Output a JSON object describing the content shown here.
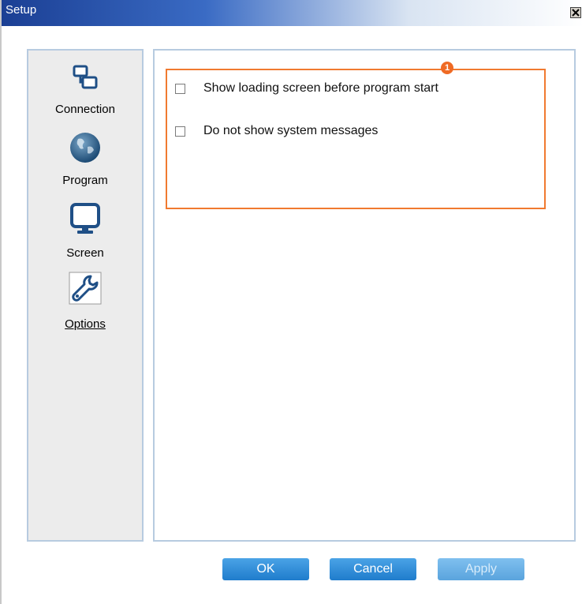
{
  "window": {
    "title": "Setup"
  },
  "sidebar": {
    "items": [
      {
        "label": "Connection",
        "icon": "connection-icon",
        "active": false
      },
      {
        "label": "Program",
        "icon": "globe-icon",
        "active": false
      },
      {
        "label": "Screen",
        "icon": "monitor-icon",
        "active": false
      },
      {
        "label": "Options",
        "icon": "wrench-icon",
        "active": true
      }
    ]
  },
  "panel": {
    "marker": "1",
    "options": [
      {
        "label": "Show loading screen before program start",
        "checked": false
      },
      {
        "label": "Do not show system messages",
        "checked": false
      }
    ]
  },
  "buttons": {
    "ok": "OK",
    "cancel": "Cancel",
    "apply": "Apply"
  },
  "colors": {
    "accent": "#f07a30",
    "button": "#1f7ccc",
    "border": "#b7cbe0"
  }
}
